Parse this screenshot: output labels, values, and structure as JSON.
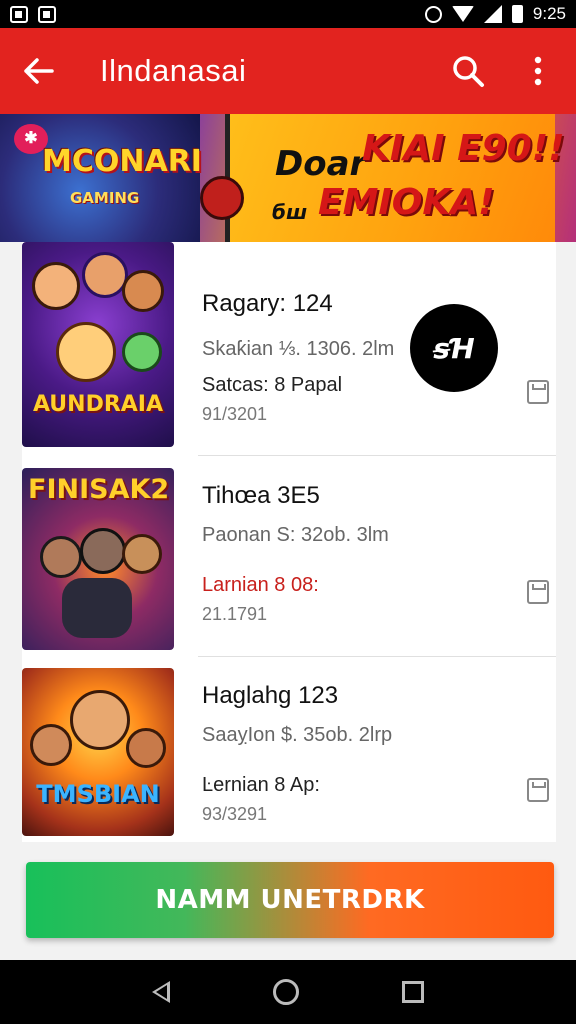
{
  "status_bar": {
    "time": "9:25"
  },
  "app_bar": {
    "title": "Ilndanasai"
  },
  "banner": {
    "left_title": "MCONARI",
    "left_sub": "GAMING",
    "right_word1": "Doar",
    "right_word2": "KIAI E90!!",
    "right_word3": "ЕMIOKA!",
    "right_small": "бш"
  },
  "games": [
    {
      "thumb_title": "AUNDRAIA",
      "title": "Ragary: 124",
      "subtitle": "Skaƙian ⅓. 1306. 2lm",
      "meta": "Satcas: 8 Papal",
      "code": "91/3201",
      "meta_color": "dark"
    },
    {
      "thumb_title": "FINISAK2",
      "title": "Tihœa 3E5",
      "subtitle": "Paonan S: 32ob. 3lm",
      "meta": "Larnian 8 08:",
      "code": "21.1791",
      "meta_color": "red"
    },
    {
      "thumb_title": "TMSBIAN",
      "title": "Haglahg 123",
      "subtitle": "SaaỵIon $. 35ob. 2lrp",
      "meta": "Ŀernian 8 Ap:",
      "code": "93/3291",
      "meta_color": "dark"
    }
  ],
  "fab": {
    "label": "ꞩꞪ"
  },
  "cta": {
    "label": "NAMM UNETRDRK"
  },
  "colors": {
    "app_bar": "#e2231f",
    "cta_start": "#18c05a",
    "cta_end": "#ff5a10",
    "red_text": "#c8201c"
  }
}
